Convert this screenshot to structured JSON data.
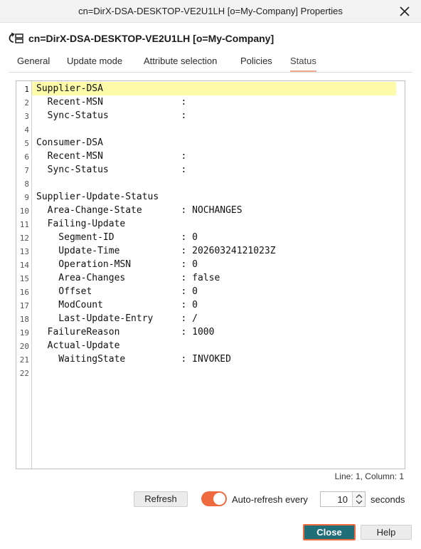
{
  "window": {
    "title": "cn=DirX-DSA-DESKTOP-VE2U1LH [o=My-Company] Properties"
  },
  "header": {
    "object_name": "cn=DirX-DSA-DESKTOP-VE2U1LH [o=My-Company]"
  },
  "tabs": [
    {
      "label": "General"
    },
    {
      "label": "Update mode"
    },
    {
      "label": "Attribute selection"
    },
    {
      "label": "Policies"
    },
    {
      "label": "Status",
      "active": true
    }
  ],
  "editor": {
    "current_line": 1,
    "lines": [
      {
        "num": "1",
        "text": "Supplier-DSA"
      },
      {
        "num": "2",
        "text": "  Recent-MSN              :"
      },
      {
        "num": "3",
        "text": "  Sync-Status             :"
      },
      {
        "num": "4",
        "text": ""
      },
      {
        "num": "5",
        "text": "Consumer-DSA"
      },
      {
        "num": "6",
        "text": "  Recent-MSN              :"
      },
      {
        "num": "7",
        "text": "  Sync-Status             :"
      },
      {
        "num": "8",
        "text": ""
      },
      {
        "num": "9",
        "text": "Supplier-Update-Status"
      },
      {
        "num": "10",
        "text": "  Area-Change-State       : NOCHANGES"
      },
      {
        "num": "11",
        "text": "  Failing-Update"
      },
      {
        "num": "12",
        "text": "    Segment-ID            : 0"
      },
      {
        "num": "13",
        "text": "    Update-Time           : 20260324121023Z"
      },
      {
        "num": "14",
        "text": "    Operation-MSN         : 0"
      },
      {
        "num": "15",
        "text": "    Area-Changes          : false"
      },
      {
        "num": "16",
        "text": "    Offset                : 0"
      },
      {
        "num": "17",
        "text": "    ModCount              : 0"
      },
      {
        "num": "18",
        "text": "    Last-Update-Entry     : /"
      },
      {
        "num": "19",
        "text": "  FailureReason           : 1000"
      },
      {
        "num": "20",
        "text": "  Actual-Update"
      },
      {
        "num": "21",
        "text": "    WaitingState          : INVOKED"
      },
      {
        "num": "22",
        "text": ""
      }
    ]
  },
  "status": {
    "cursor_position": "Line: 1, Column: 1"
  },
  "controls": {
    "refresh_label": "Refresh",
    "auto_refresh_enabled": true,
    "auto_refresh_label": "Auto-refresh every",
    "interval_value": "10",
    "seconds_label": "seconds"
  },
  "footer": {
    "close_label": "Close",
    "help_label": "Help"
  },
  "colors": {
    "accent": "#ef6b3f",
    "primary_button": "#1f6e78",
    "line_highlight": "#fdfaa8"
  },
  "icons": {
    "window_close": "close-icon",
    "object": "replication-agreement-icon",
    "spinner": "spinner-arrows-icon"
  }
}
